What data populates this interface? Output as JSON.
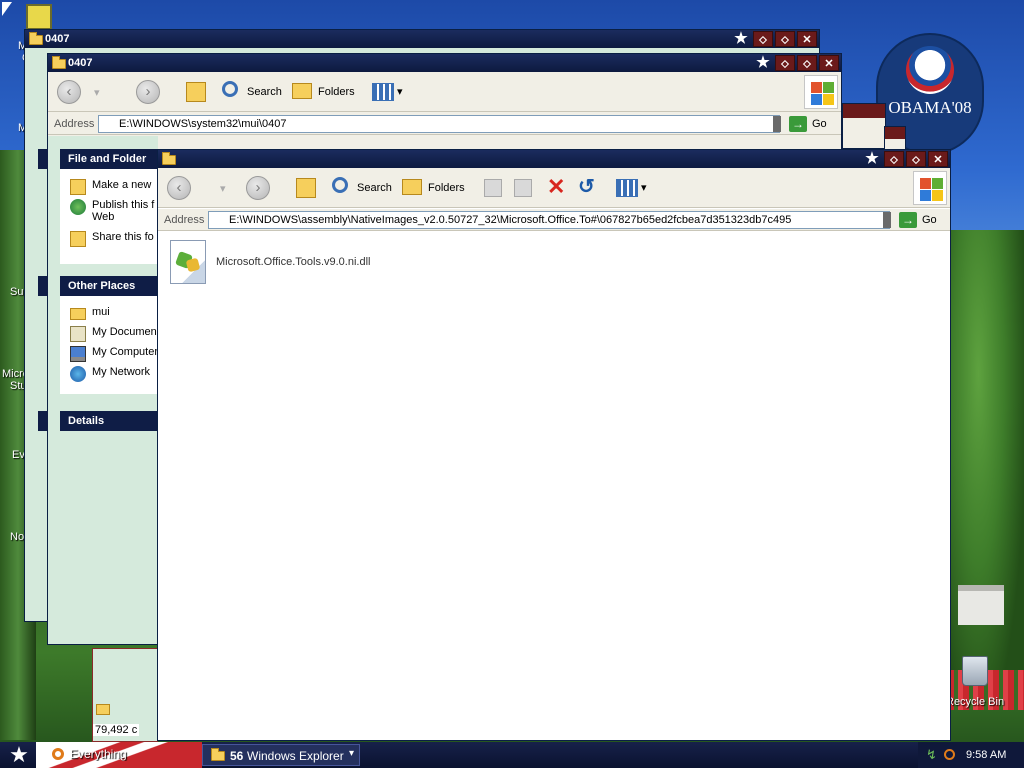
{
  "desktop": {
    "labels": [
      "M",
      "C",
      "M",
      "Su",
      "Micro",
      "Stu",
      "Ev",
      "No"
    ],
    "recycle_bin": "Recycle Bin",
    "obama_text": "OBAMA'08"
  },
  "back_window": {
    "title": "0407"
  },
  "mid_window": {
    "title": "0407",
    "toolbar": {
      "search": "Search",
      "folders": "Folders"
    },
    "address_label": "Address",
    "address": "E:\\WINDOWS\\system32\\mui\\0407",
    "go": "Go",
    "tasks": {
      "header": "File and Folder",
      "items": [
        "Make a new",
        "Publish this f",
        "Web",
        "Share this fo"
      ]
    },
    "other_places": {
      "header": "Other Places",
      "items": [
        "mui",
        "My Documen",
        "My Computer",
        "My Network"
      ]
    },
    "details": {
      "header": "Details"
    },
    "status": "79,492 c"
  },
  "front_window": {
    "toolbar": {
      "search": "Search",
      "folders": "Folders"
    },
    "address_label": "Address",
    "address": "E:\\WINDOWS\\assembly\\NativeImages_v2.0.50727_32\\Microsoft.Office.To#\\067827b65ed2fcbea7d351323db7c495",
    "go": "Go",
    "files": [
      {
        "name": "Microsoft.Office.Tools.v9.0.ni.dll",
        "icon": "dll-file-icon"
      }
    ]
  },
  "taskbar": {
    "start_label": "Everything",
    "group_count": "56",
    "group_label": "Windows Explorer",
    "clock": "9:58 AM"
  },
  "colors": {
    "title_bar": "#0d1a3f",
    "task_pane_header": "#0f1d46",
    "accent_red": "#c8272d"
  }
}
